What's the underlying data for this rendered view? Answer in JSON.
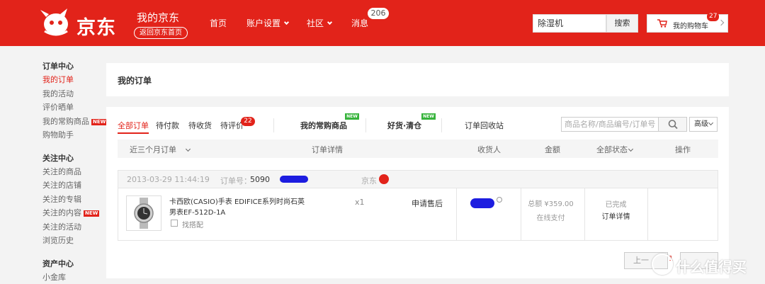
{
  "header": {
    "logo_text": "京东",
    "my_jd": "我的京东",
    "back_home": "返回京东首页",
    "nav": [
      {
        "label": "首页",
        "dropdown": false
      },
      {
        "label": "账户设置",
        "dropdown": true
      },
      {
        "label": "社区",
        "dropdown": true
      },
      {
        "label": "消息",
        "dropdown": false
      }
    ],
    "message_count": "206",
    "search_value": "除湿机",
    "search_button": "搜索",
    "cart_label": "我的购物车",
    "cart_count": "27",
    "brand_color": "#e2231a"
  },
  "sidebar": {
    "groups": [
      {
        "title": "订单中心",
        "items": [
          {
            "label": "我的订单",
            "active": true,
            "new": false
          },
          {
            "label": "我的活动",
            "active": false,
            "new": false
          },
          {
            "label": "评价晒单",
            "active": false,
            "new": false
          },
          {
            "label": "我的常购商品",
            "active": false,
            "new": true
          },
          {
            "label": "购物助手",
            "active": false,
            "new": false
          }
        ]
      },
      {
        "title": "关注中心",
        "items": [
          {
            "label": "关注的商品",
            "active": false,
            "new": false
          },
          {
            "label": "关注的店铺",
            "active": false,
            "new": false
          },
          {
            "label": "关注的专辑",
            "active": false,
            "new": false
          },
          {
            "label": "关注的内容",
            "active": false,
            "new": true
          },
          {
            "label": "关注的活动",
            "active": false,
            "new": false
          },
          {
            "label": "浏览历史",
            "active": false,
            "new": false
          }
        ]
      },
      {
        "title": "资产中心",
        "items": [
          {
            "label": "小金库",
            "active": false,
            "new": false
          }
        ]
      }
    ],
    "new_tag": "NEW"
  },
  "main": {
    "page_title": "我的订单",
    "tabs": {
      "all": "全部订单",
      "pending_pay": "待付款",
      "pending_receive": "待收货",
      "pending_review": "待评价",
      "review_count": "22",
      "frequent": "我的常购商品",
      "clearance": "好货·清仓",
      "recycle": "订单回收站",
      "new_badge": "NEW"
    },
    "order_search_placeholder": "商品名称/商品编号/订单号",
    "advanced": "高级",
    "columns": {
      "range": "近三个月订单",
      "details": "订单详情",
      "receiver": "收货人",
      "amount": "金额",
      "status": "全部状态",
      "action": "操作"
    },
    "order": {
      "datetime": "2013-03-29 11:44:19",
      "number_label": "订单号：",
      "number_prefix": "5090",
      "shop": "京东",
      "product_name": "卡西欧(CASIO)手表 EDIFICE系列时尚石英男表EF-512D-1A",
      "match": "找搭配",
      "quantity": "x1",
      "after_sale": "申请售后",
      "total": "总额 ¥359.00",
      "payment": "在线支付",
      "status": "已完成",
      "detail_link": "订单详情"
    },
    "pager": {
      "prev": "上一",
      "current": "1"
    }
  },
  "watermark": {
    "text": "什么值得买",
    "symbol": "值"
  }
}
